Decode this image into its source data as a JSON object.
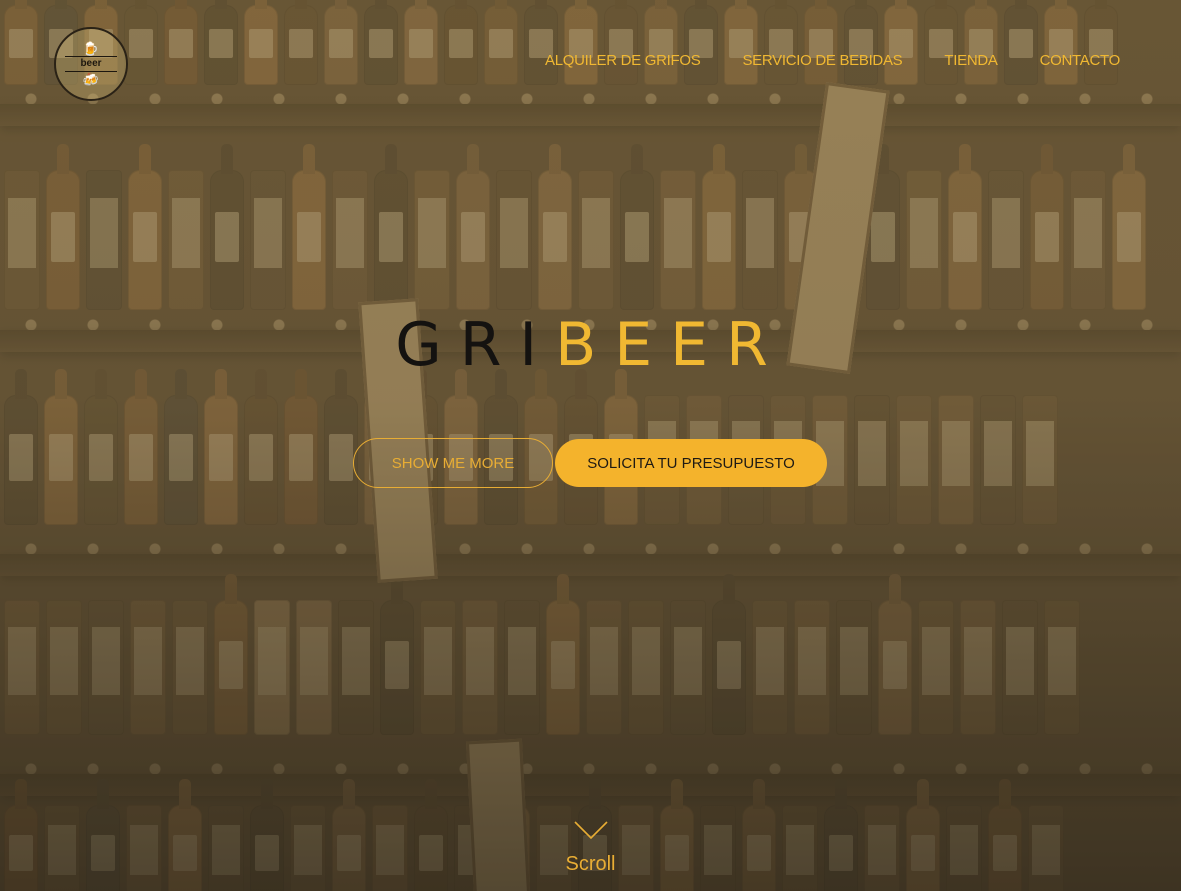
{
  "header": {
    "logo_top": "🍺",
    "logo_text": "beer",
    "logo_bottom": "🍻"
  },
  "nav": {
    "items": [
      "ALQUILER DE GRIFOS",
      "SERVICIO DE BEBIDAS",
      "TIENDA",
      "CONTACTO"
    ]
  },
  "hero": {
    "title_dark": "GRI",
    "title_light": "BEER",
    "buttons": {
      "show_more": "SHOW ME MORE",
      "quote": "SOLICITA TU PRESUPUESTO"
    }
  },
  "scroll": {
    "label": "Scroll",
    "icon": "chevron-down-icon"
  },
  "colors": {
    "accent": "#f0b832",
    "button_fill": "#f4b32c",
    "title_dark": "#141210"
  }
}
